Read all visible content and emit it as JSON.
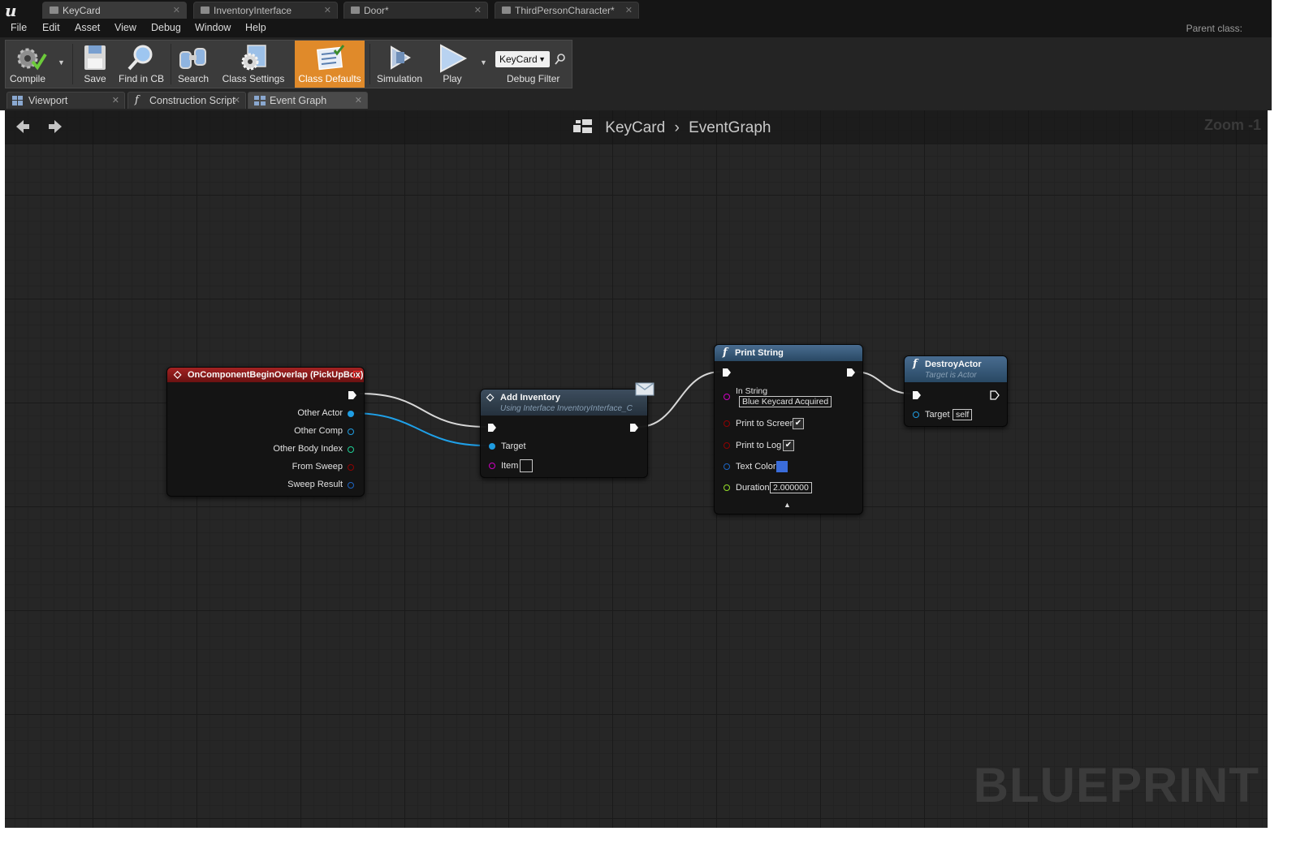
{
  "document_tabs": [
    {
      "label": "KeyCard"
    },
    {
      "label": "InventoryInterface"
    },
    {
      "label": "Door*"
    },
    {
      "label": "ThirdPersonCharacter*"
    }
  ],
  "menu": [
    "File",
    "Edit",
    "Asset",
    "View",
    "Debug",
    "Window",
    "Help"
  ],
  "parent_class_label": "Parent class:",
  "toolbar": {
    "compile": "Compile",
    "save": "Save",
    "find_in_cb": "Find in CB",
    "search": "Search",
    "class_settings": "Class Settings",
    "class_defaults": "Class Defaults",
    "simulation": "Simulation",
    "play": "Play",
    "debug_object": "KeyCard",
    "debug_filter": "Debug Filter"
  },
  "panel_tabs": [
    {
      "label": "Viewport"
    },
    {
      "label": "Construction Script"
    },
    {
      "label": "Event Graph"
    }
  ],
  "graph": {
    "breadcrumb_root": "KeyCard",
    "breadcrumb_leaf": "EventGraph",
    "zoom": "Zoom -1",
    "watermark": "BLUEPRINT"
  },
  "nodes": {
    "overlap_event": {
      "title": "OnComponentBeginOverlap (PickUpBox)",
      "pins": [
        "Other Actor",
        "Other Comp",
        "Other Body Index",
        "From Sweep",
        "Sweep Result"
      ]
    },
    "add_inventory": {
      "title": "Add Inventory",
      "subtitle": "Using Interface InventoryInterface_C",
      "pins": [
        "Target",
        "Item"
      ]
    },
    "print_string": {
      "title": "Print String",
      "in_string_label": "In String",
      "in_string_value": "Blue Keycard Acquired",
      "print_to_screen": "Print to Screen",
      "print_to_log": "Print to Log",
      "text_color": "Text Color",
      "text_color_value": "#3b6fe0",
      "duration": "Duration",
      "duration_value": "2.000000"
    },
    "destroy_actor": {
      "title": "DestroyActor",
      "subtitle": "Target is Actor",
      "target_label": "Target",
      "target_value": "self"
    }
  },
  "colors": {
    "accent_active_button": "#e08a2a",
    "event_header": "#8a1c1c",
    "function_header": "#2a4a66",
    "object_pin": "#1fa0e8",
    "struct_pin": "#1d67c8",
    "int_pin": "#1fd69a",
    "bool_pin": "#920000",
    "string_pin": "#d500c8",
    "float_pin": "#9ae62a"
  }
}
